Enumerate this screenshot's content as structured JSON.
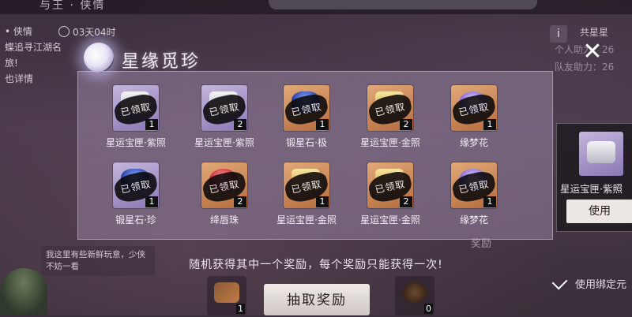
{
  "topbar": {
    "left_text": "与王 · 侠情"
  },
  "left_info": {
    "line1": "• 侠情",
    "countdown": "03天04时",
    "line2": "蝶追寻江湖名",
    "line3": "旅!",
    "line4": "也详情"
  },
  "side_bubble": {
    "text": "我这里有些新鲜玩意，少侠不妨一看"
  },
  "right_info": {
    "info_glyph": "i",
    "line1": "共星星",
    "line2": "个人助力：26",
    "line3": "队友助力：26"
  },
  "dialog": {
    "title": "星缘觅珍",
    "stamp_text": "已领取",
    "rows": [
      [
        {
          "name": "星运宝匣·紫照",
          "count": "1",
          "bg": "purple",
          "icon": "chest-icon"
        },
        {
          "name": "星运宝匣·紫照",
          "count": "2",
          "bg": "purple",
          "icon": "chest-icon"
        },
        {
          "name": "锻星石·极",
          "count": "1",
          "bg": "orange",
          "icon": "ore-icon"
        },
        {
          "name": "星运宝匣·金照",
          "count": "2",
          "bg": "orange",
          "icon": "gold-chest-icon"
        },
        {
          "name": "缘梦花",
          "count": "1",
          "bg": "orange",
          "icon": "flower-icon"
        }
      ],
      [
        {
          "name": "锻星石·珍",
          "count": "1",
          "bg": "purple",
          "icon": "ore-icon"
        },
        {
          "name": "绛唇珠",
          "count": "2",
          "bg": "orange",
          "icon": "pearl-icon"
        },
        {
          "name": "星运宝匣·金照",
          "count": "1",
          "bg": "orange",
          "icon": "gold-chest-icon"
        },
        {
          "name": "星运宝匣·金照",
          "count": "2",
          "bg": "orange",
          "icon": "gold-chest-icon"
        },
        {
          "name": "缘梦花",
          "count": "1",
          "bg": "orange",
          "icon": "flower-icon"
        }
      ]
    ]
  },
  "notice": "随机获得其中一个奖励，每个奖励只能获得一次!",
  "claim_button": "抽取奖励",
  "bottom_slots": [
    {
      "count": "1"
    },
    {
      "count": "0"
    }
  ],
  "right_panel": {
    "name": "星运宝匣·紫照",
    "use_label": "使用"
  },
  "bind_option": "使用绑定元",
  "reward_shadow": "奖励"
}
